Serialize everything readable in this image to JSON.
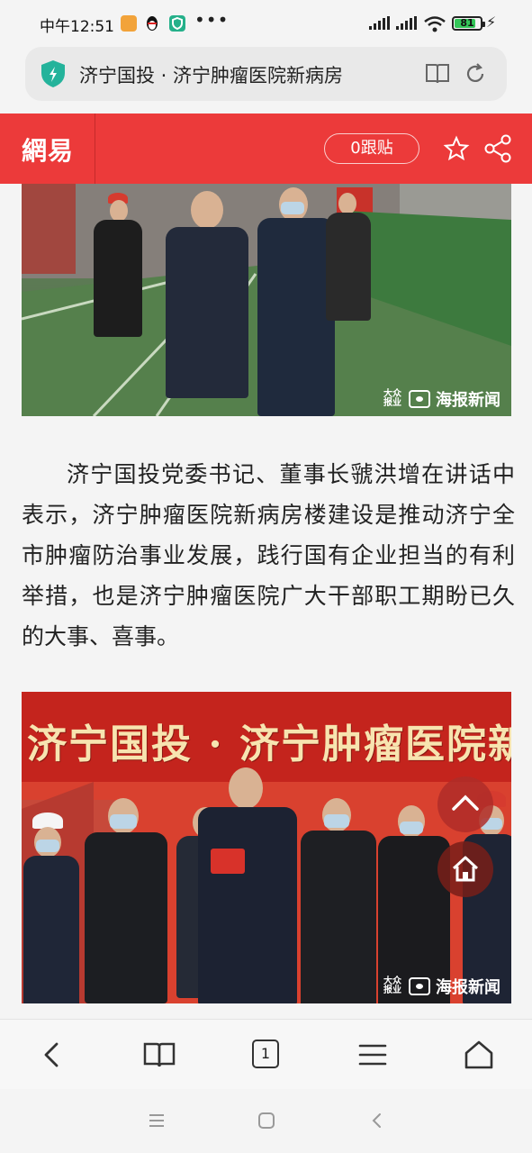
{
  "status_bar": {
    "time": "中午12:51",
    "more": "•••",
    "battery": "81",
    "battery_level": 0.81
  },
  "address_bar": {
    "title": "济宁国投 · 济宁肿瘤医院新病房"
  },
  "header": {
    "logo": "網易",
    "follow_label": "0跟贴"
  },
  "article": {
    "paragraph": "济宁国投党委书记、董事长虢洪增在讲话中表示，济宁肿瘤医院新病房楼建设是推动济宁全市肿瘤防治事业发展，践行国有企业担当的有利举措，也是济宁肿瘤医院广大干部职工期盼已久的大事、喜事。",
    "photo2_banner": "济宁国投 · 济宁肿瘤医院新",
    "watermark": "海报新闻",
    "watermark_badge": "大众报业"
  },
  "toolbar": {
    "tab_count": "1"
  },
  "colors": {
    "brand_red": "#ec3a3a",
    "shield_green": "#24b39b"
  }
}
